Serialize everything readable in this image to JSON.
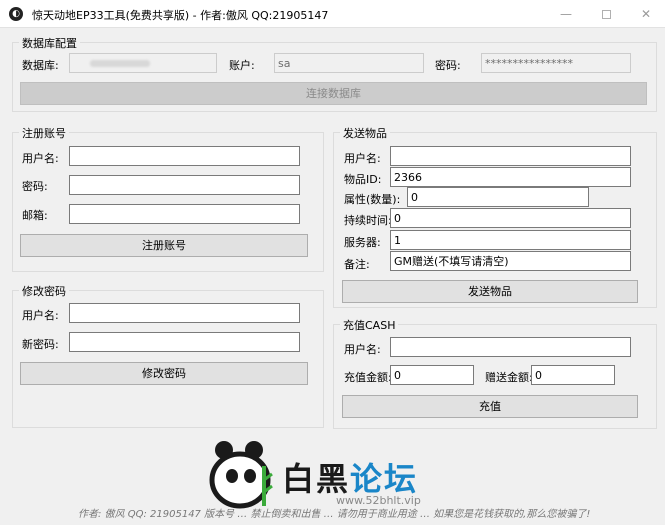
{
  "window": {
    "title": "惊天动地EP33工具(免费共享版) - 作者:傲风 QQ:21905147",
    "minimize": "—",
    "close": "✕"
  },
  "db_group": {
    "title": "数据库配置",
    "db_label": "数据库:",
    "db_value": "",
    "user_label": "账户:",
    "user_value": "sa",
    "pwd_label": "密码:",
    "pwd_value": "****************",
    "connect_button": "连接数据库"
  },
  "register_group": {
    "title": "注册账号",
    "username_label": "用户名:",
    "username_value": "",
    "password_label": "密码:",
    "password_value": "",
    "email_label": "邮箱:",
    "email_value": "",
    "submit_button": "注册账号"
  },
  "change_pwd_group": {
    "title": "修改密码",
    "username_label": "用户名:",
    "username_value": "",
    "new_pwd_label": "新密码:",
    "new_pwd_value": "",
    "submit_button": "修改密码"
  },
  "send_item_group": {
    "title": "发送物品",
    "username_label": "用户名:",
    "username_value": "",
    "item_id_label": "物品ID:",
    "item_id_value": "2366",
    "attr_label": "属性(数量):",
    "attr_value": "0",
    "duration_label": "持续时间:",
    "duration_value": "0",
    "server_label": "服务器:",
    "server_value": "1",
    "note_label": "备注:",
    "note_value": "GM赠送(不填写请清空)",
    "submit_button": "发送物品"
  },
  "cash_group": {
    "title": "充值CASH",
    "username_label": "用户名:",
    "username_value": "",
    "amount_label": "充值金额:",
    "amount_value": "0",
    "bonus_label": "赠送金额:",
    "bonus_value": "0",
    "submit_button": "充值"
  },
  "footer": {
    "text": "作者: 傲风   QQ: 21905147     版本号 … 禁止倒卖和出售 … 请勿用于商业用途 … 如果您是花钱获取的,那么您被骗了!"
  },
  "watermark": {
    "title_part1": "白黑",
    "title_part2": "论坛",
    "url": "www.52bhlt.vip"
  }
}
